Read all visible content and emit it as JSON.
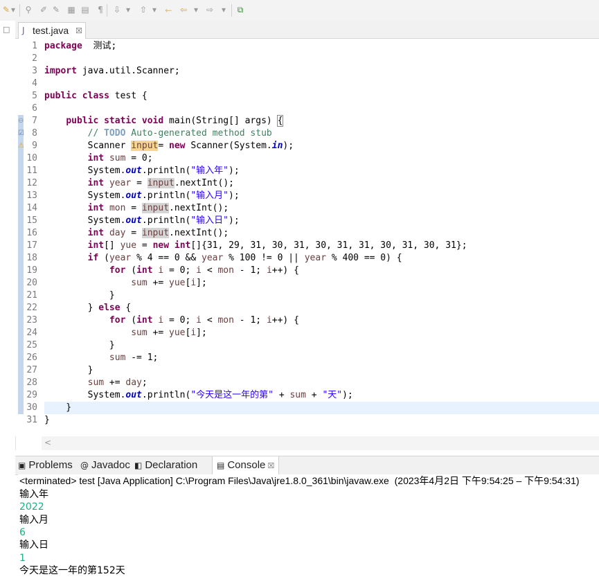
{
  "toolbar": {
    "icons": [
      "dropdown-arrow",
      "perspective",
      "toggle-mark",
      "toggle-breadcrumb",
      "toggle-block",
      "whitespace",
      "paragraph",
      "annotation-next",
      "annotation-prev",
      "back",
      "forward",
      "pin"
    ]
  },
  "editor": {
    "tab": {
      "label": "test.java",
      "close": "☒"
    },
    "lines": [
      {
        "n": "1",
        "segs": [
          [
            "kw",
            "package"
          ],
          [
            "",
            "  测试;"
          ]
        ]
      },
      {
        "n": "2",
        "segs": []
      },
      {
        "n": "3",
        "segs": [
          [
            "kw",
            "import"
          ],
          [
            "",
            " java.util.Scanner;"
          ]
        ]
      },
      {
        "n": "4",
        "segs": []
      },
      {
        "n": "5",
        "segs": [
          [
            "kw",
            "public class"
          ],
          [
            "",
            " test {"
          ]
        ]
      },
      {
        "n": "6",
        "segs": []
      },
      {
        "n": "7",
        "segs": [
          [
            "",
            "    "
          ],
          [
            "kw",
            "public static void"
          ],
          [
            "",
            " main(String[] args) "
          ],
          [
            "brk",
            "{"
          ]
        ]
      },
      {
        "n": "8",
        "segs": [
          [
            "",
            "        "
          ],
          [
            "cm",
            "// "
          ],
          [
            "cmtodo",
            "TODO"
          ],
          [
            "cm",
            " Auto-generated method stub"
          ]
        ]
      },
      {
        "n": "9",
        "segs": [
          [
            "",
            "        Scanner "
          ],
          [
            "var occw",
            "input"
          ],
          [
            "",
            "= "
          ],
          [
            "kw",
            "new"
          ],
          [
            "",
            " Scanner(System."
          ],
          [
            "fld",
            "in"
          ],
          [
            "",
            ");"
          ]
        ]
      },
      {
        "n": "10",
        "segs": [
          [
            "",
            "        "
          ],
          [
            "kw",
            "int"
          ],
          [
            "",
            " "
          ],
          [
            "var",
            "sum"
          ],
          [
            "",
            " = 0;"
          ]
        ]
      },
      {
        "n": "11",
        "segs": [
          [
            "",
            "        System."
          ],
          [
            "fld",
            "out"
          ],
          [
            "",
            ".println("
          ],
          [
            "str",
            "\"输入年\""
          ],
          [
            "",
            ");"
          ]
        ]
      },
      {
        "n": "12",
        "segs": [
          [
            "",
            "        "
          ],
          [
            "kw",
            "int"
          ],
          [
            "",
            " "
          ],
          [
            "var",
            "year"
          ],
          [
            "",
            " = "
          ],
          [
            "var occ",
            "input"
          ],
          [
            "",
            ".nextInt();"
          ]
        ]
      },
      {
        "n": "13",
        "segs": [
          [
            "",
            "        System."
          ],
          [
            "fld",
            "out"
          ],
          [
            "",
            ".println("
          ],
          [
            "str",
            "\"输入月\""
          ],
          [
            "",
            ");"
          ]
        ]
      },
      {
        "n": "14",
        "segs": [
          [
            "",
            "        "
          ],
          [
            "kw",
            "int"
          ],
          [
            "",
            " "
          ],
          [
            "var",
            "mon"
          ],
          [
            "",
            " = "
          ],
          [
            "var occ",
            "input"
          ],
          [
            "",
            ".nextInt();"
          ]
        ]
      },
      {
        "n": "15",
        "segs": [
          [
            "",
            "        System."
          ],
          [
            "fld",
            "out"
          ],
          [
            "",
            ".println("
          ],
          [
            "str",
            "\"输入日\""
          ],
          [
            "",
            ");"
          ]
        ]
      },
      {
        "n": "16",
        "segs": [
          [
            "",
            "        "
          ],
          [
            "kw",
            "int"
          ],
          [
            "",
            " "
          ],
          [
            "var",
            "day"
          ],
          [
            "",
            " = "
          ],
          [
            "var occ",
            "input"
          ],
          [
            "",
            ".nextInt();"
          ]
        ]
      },
      {
        "n": "17",
        "segs": [
          [
            "",
            "        "
          ],
          [
            "kw",
            "int"
          ],
          [
            "",
            "[] "
          ],
          [
            "var",
            "yue"
          ],
          [
            "",
            " = "
          ],
          [
            "kw",
            "new"
          ],
          [
            "",
            " "
          ],
          [
            "kw",
            "int"
          ],
          [
            "",
            "[]{31, 29, 31, 30, 31, 30, 31, 31, 30, 31, 30, 31};"
          ]
        ]
      },
      {
        "n": "18",
        "segs": [
          [
            "",
            "        "
          ],
          [
            "kw",
            "if"
          ],
          [
            "",
            " ("
          ],
          [
            "var",
            "year"
          ],
          [
            "",
            " % 4 == 0 && "
          ],
          [
            "var",
            "year"
          ],
          [
            "",
            " % 100 != 0 || "
          ],
          [
            "var",
            "year"
          ],
          [
            "",
            " % 400 == 0) {"
          ]
        ]
      },
      {
        "n": "19",
        "segs": [
          [
            "",
            "            "
          ],
          [
            "kw",
            "for"
          ],
          [
            "",
            " ("
          ],
          [
            "kw",
            "int"
          ],
          [
            "",
            " "
          ],
          [
            "var",
            "i"
          ],
          [
            "",
            " = 0; "
          ],
          [
            "var",
            "i"
          ],
          [
            "",
            " < "
          ],
          [
            "var",
            "mon"
          ],
          [
            "",
            " - 1; "
          ],
          [
            "var",
            "i"
          ],
          [
            "",
            "++) {"
          ]
        ]
      },
      {
        "n": "20",
        "segs": [
          [
            "",
            "                "
          ],
          [
            "var",
            "sum"
          ],
          [
            "",
            " += "
          ],
          [
            "var",
            "yue"
          ],
          [
            "",
            "["
          ],
          [
            "var",
            "i"
          ],
          [
            "",
            "];"
          ]
        ]
      },
      {
        "n": "21",
        "segs": [
          [
            "",
            "            }"
          ]
        ]
      },
      {
        "n": "22",
        "segs": [
          [
            "",
            "        } "
          ],
          [
            "kw",
            "else"
          ],
          [
            "",
            " {"
          ]
        ]
      },
      {
        "n": "23",
        "segs": [
          [
            "",
            "            "
          ],
          [
            "kw",
            "for"
          ],
          [
            "",
            " ("
          ],
          [
            "kw",
            "int"
          ],
          [
            "",
            " "
          ],
          [
            "var",
            "i"
          ],
          [
            "",
            " = 0; "
          ],
          [
            "var",
            "i"
          ],
          [
            "",
            " < "
          ],
          [
            "var",
            "mon"
          ],
          [
            "",
            " - 1; "
          ],
          [
            "var",
            "i"
          ],
          [
            "",
            "++) {"
          ]
        ]
      },
      {
        "n": "24",
        "segs": [
          [
            "",
            "                "
          ],
          [
            "var",
            "sum"
          ],
          [
            "",
            " += "
          ],
          [
            "var",
            "yue"
          ],
          [
            "",
            "["
          ],
          [
            "var",
            "i"
          ],
          [
            "",
            "];"
          ]
        ]
      },
      {
        "n": "25",
        "segs": [
          [
            "",
            "            }"
          ]
        ]
      },
      {
        "n": "26",
        "segs": [
          [
            "",
            "            "
          ],
          [
            "var",
            "sum"
          ],
          [
            "",
            " -= 1;"
          ]
        ]
      },
      {
        "n": "27",
        "segs": [
          [
            "",
            "        }"
          ]
        ]
      },
      {
        "n": "28",
        "segs": [
          [
            "",
            "        "
          ],
          [
            "var",
            "sum"
          ],
          [
            "",
            " += "
          ],
          [
            "var",
            "day"
          ],
          [
            "",
            ";"
          ]
        ]
      },
      {
        "n": "29",
        "segs": [
          [
            "",
            "        System."
          ],
          [
            "fld",
            "out"
          ],
          [
            "",
            ".println("
          ],
          [
            "str",
            "\"今天是这一年的第\""
          ],
          [
            "",
            " + "
          ],
          [
            "var",
            "sum"
          ],
          [
            "",
            " + "
          ],
          [
            "str",
            "\"天\""
          ],
          [
            "",
            ");"
          ]
        ]
      },
      {
        "n": "30",
        "segs": [
          [
            "",
            "    }"
          ]
        ],
        "current": true
      },
      {
        "n": "31",
        "segs": [
          [
            "",
            "}"
          ]
        ]
      }
    ]
  },
  "scroll": {
    "left_arrow": "<"
  },
  "console_tabs": [
    {
      "icon": "▣",
      "label": "Problems",
      "icon_name": "problems-icon"
    },
    {
      "icon": "@",
      "label": "Javadoc",
      "icon_name": "javadoc-icon"
    },
    {
      "icon": "◧",
      "label": "Declaration",
      "icon_name": "declaration-icon"
    },
    {
      "icon": "▤",
      "label": "Console",
      "icon_name": "console-icon",
      "active": true,
      "close": "☒"
    }
  ],
  "console": {
    "header": "<terminated> test [Java Application] C:\\Program Files\\Java\\jre1.8.0_361\\bin\\javaw.exe  (2023年4月2日 下午9:54:25 – 下午9:54:31)",
    "lines": [
      {
        "text": "输入年",
        "input": false
      },
      {
        "text": "2022",
        "input": true
      },
      {
        "text": "输入月",
        "input": false
      },
      {
        "text": "6",
        "input": true
      },
      {
        "text": "输入日",
        "input": false
      },
      {
        "text": "1",
        "input": true
      },
      {
        "text": "今天是这一年的第152天",
        "input": false
      }
    ]
  }
}
